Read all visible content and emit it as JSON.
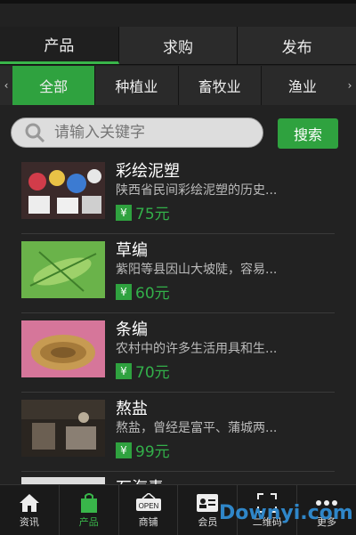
{
  "tabs": [
    "产品",
    "求购",
    "发布"
  ],
  "categories": [
    "全部",
    "种植业",
    "畜牧业",
    "渔业"
  ],
  "search": {
    "placeholder": "请输入关键字",
    "button": "搜索"
  },
  "items": [
    {
      "title": "彩绘泥塑",
      "desc": "陕西省民间彩绘泥塑的历史...",
      "price": "75元"
    },
    {
      "title": "草编",
      "desc": "紫阳等县因山大坡陡，容易...",
      "price": "60元"
    },
    {
      "title": "条编",
      "desc": "农村中的许多生活用具和生...",
      "price": "70元"
    },
    {
      "title": "熬盐",
      "desc": "熬盐，曾经是富平、蒲城两...",
      "price": "99元"
    }
  ],
  "partial_title": "石海青",
  "yen": "¥",
  "nav": [
    "资讯",
    "产品",
    "商铺",
    "会员",
    "二维码",
    "更多"
  ],
  "watermark": "Downyi.com",
  "colors": {
    "accent": "#2fa23f"
  }
}
